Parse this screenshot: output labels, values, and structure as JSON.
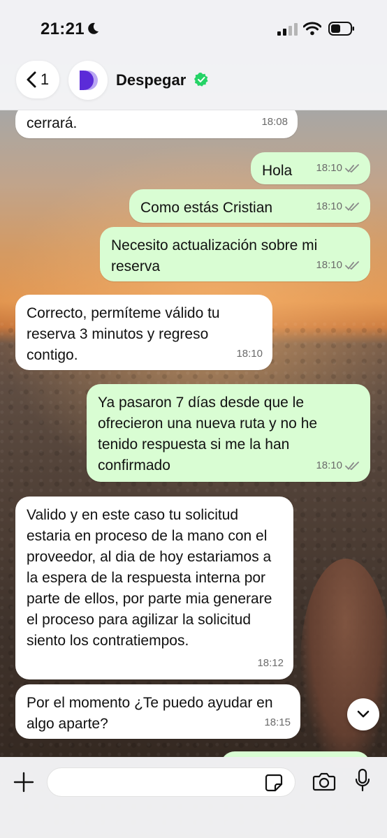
{
  "status_bar": {
    "time": "21:21"
  },
  "header": {
    "back_count": "1",
    "contact_name": "Despegar"
  },
  "messages": [
    {
      "direction": "in",
      "text": "cerrará.",
      "time": "18:08"
    },
    {
      "direction": "out",
      "text": "Hola",
      "time": "18:10"
    },
    {
      "direction": "out",
      "text": "Como estás Cristian",
      "time": "18:10"
    },
    {
      "direction": "out",
      "text": "Necesito actualización sobre mi reserva",
      "time": "18:10"
    },
    {
      "direction": "in",
      "text": "Correcto, permíteme válido tu reserva 3 minutos y regreso contigo.",
      "time": "18:10"
    },
    {
      "direction": "out",
      "text": "Ya pasaron 7 días desde que le ofrecieron una nueva ruta y no he tenido respuesta si me la han confirmado",
      "time": "18:10"
    },
    {
      "direction": "in",
      "text": "Valido y en este caso tu solicitud estaria en proceso de la mano con el proveedor, al dia de hoy estariamos a la espera de la respuesta interna por parte de ellos, por parte mia generare el proceso para agilizar la solicitud siento los contratiempos.",
      "time": "18:12"
    },
    {
      "direction": "in",
      "text": "Por el momento ¿Te puedo ayudar en algo aparte?",
      "time": "18:15"
    }
  ],
  "composer": {
    "input_value": ""
  },
  "colors": {
    "outgoing_bubble": "#d9fdd3",
    "incoming_bubble": "#ffffff",
    "read_ticks": "#8a8a8a",
    "verified_badge": "#25d366",
    "brand_avatar": "#5b2bd8"
  },
  "icons": [
    "moon-icon",
    "signal-icon",
    "wifi-icon",
    "battery-icon",
    "back-chevron-icon",
    "despegar-logo",
    "verified-badge-icon",
    "double-check-icon",
    "chevron-down-icon",
    "plus-icon",
    "sticker-icon",
    "camera-icon",
    "microphone-icon"
  ]
}
